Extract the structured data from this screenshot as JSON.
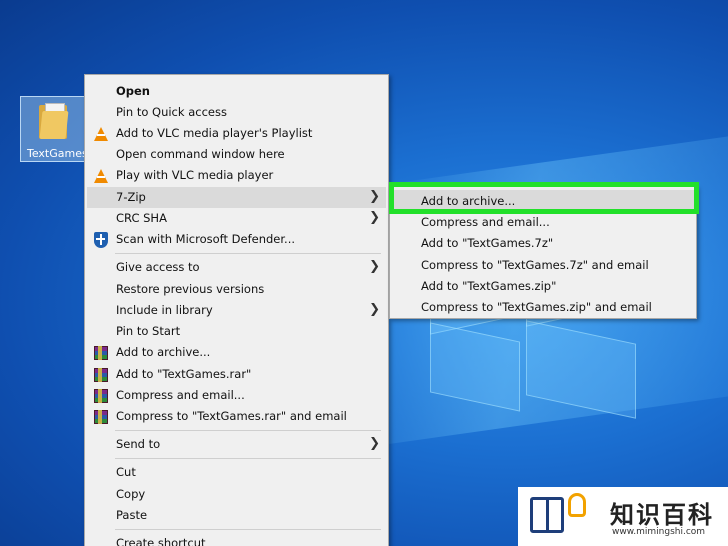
{
  "desktop": {
    "icon_label": "TextGames"
  },
  "context_menu": {
    "items": [
      {
        "label": "Open",
        "bold": true,
        "icon": "",
        "submenu": false
      },
      {
        "label": "Pin to Quick access",
        "icon": "",
        "submenu": false
      },
      {
        "label": "Add to VLC media player's Playlist",
        "icon": "vlc-icon",
        "submenu": false
      },
      {
        "label": "Open command window here",
        "icon": "",
        "submenu": false
      },
      {
        "label": "Play with VLC media player",
        "icon": "vlc-icon",
        "submenu": false
      },
      {
        "label": "7-Zip",
        "icon": "",
        "submenu": true,
        "hover": true
      },
      {
        "label": "CRC SHA",
        "icon": "",
        "submenu": true
      },
      {
        "label": "Scan with Microsoft Defender...",
        "icon": "defender-shield-icon",
        "submenu": false
      },
      {
        "label": "Give access to",
        "icon": "",
        "submenu": true
      },
      {
        "label": "Restore previous versions",
        "icon": "",
        "submenu": false
      },
      {
        "label": "Include in library",
        "icon": "",
        "submenu": true
      },
      {
        "label": "Pin to Start",
        "icon": "",
        "submenu": false
      },
      {
        "label": "Add to archive...",
        "icon": "winrar-icon",
        "submenu": false
      },
      {
        "label": "Add to \"TextGames.rar\"",
        "icon": "winrar-icon",
        "submenu": false
      },
      {
        "label": "Compress and email...",
        "icon": "winrar-icon",
        "submenu": false
      },
      {
        "label": "Compress to \"TextGames.rar\" and email",
        "icon": "winrar-icon",
        "submenu": false
      },
      {
        "label": "Send to",
        "icon": "",
        "submenu": true
      },
      {
        "label": "Cut",
        "icon": "",
        "submenu": false
      },
      {
        "label": "Copy",
        "icon": "",
        "submenu": false
      },
      {
        "label": "Paste",
        "icon": "",
        "submenu": false
      },
      {
        "label": "Create shortcut",
        "icon": "",
        "submenu": false
      }
    ]
  },
  "zip_submenu": {
    "items": [
      {
        "label": "Add to archive...",
        "hover": true
      },
      {
        "label": "Compress and email..."
      },
      {
        "label": "Add to \"TextGames.7z\""
      },
      {
        "label": "Compress to \"TextGames.7z\" and email"
      },
      {
        "label": "Add to \"TextGames.zip\""
      },
      {
        "label": "Compress to \"TextGames.zip\" and email"
      }
    ]
  },
  "highlight_color": "#22e02a",
  "watermark": {
    "title": "知识百科",
    "url": "www.mimingshi.com"
  }
}
